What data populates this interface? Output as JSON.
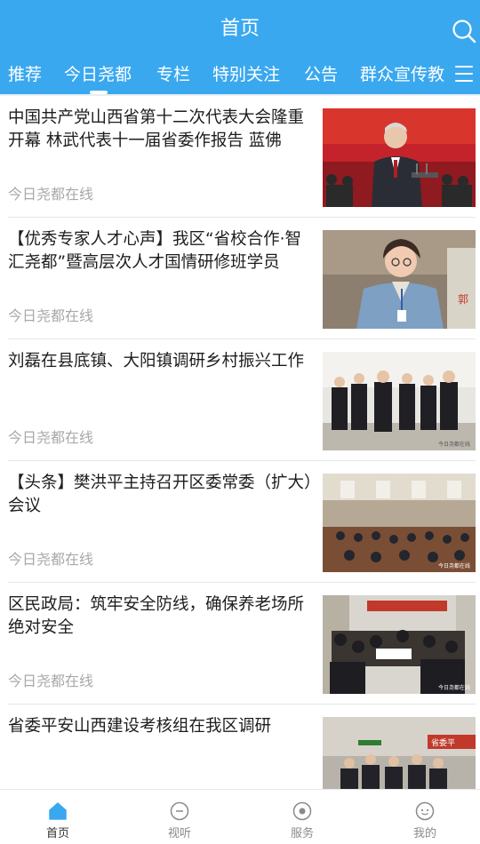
{
  "header": {
    "title": "首页",
    "tabs": [
      {
        "label": "推荐"
      },
      {
        "label": "今日尧都"
      },
      {
        "label": "专栏"
      },
      {
        "label": "特别关注"
      },
      {
        "label": "公告"
      },
      {
        "label": "群众宣传教"
      }
    ],
    "active_tab": "今日尧都",
    "accent_color": "#3aa8ef"
  },
  "articles": [
    {
      "title": "中国共产党山西省第十二次代表大会隆重开幕 林武代表十一届省委作报告 蓝佛",
      "source": "今日尧都在线"
    },
    {
      "title": "【优秀专家人才心声】我区“省校合作·智汇尧都”暨高层次人才国情研修班学员",
      "source": "今日尧都在线"
    },
    {
      "title": "刘磊在县底镇、大阳镇调研乡村振兴工作",
      "source": "今日尧都在线"
    },
    {
      "title": "【头条】樊洪平主持召开区委常委（扩大）会议",
      "source": "今日尧都在线"
    },
    {
      "title": "区民政局：筑牢安全防线，确保养老场所绝对安全",
      "source": "今日尧都在线"
    },
    {
      "title": "省委平安山西建设考核组在我区调研",
      "source": ""
    }
  ],
  "tabbar": {
    "items": [
      {
        "label": "首页",
        "icon": "home-icon"
      },
      {
        "label": "视听",
        "icon": "video-icon"
      },
      {
        "label": "服务",
        "icon": "service-icon"
      },
      {
        "label": "我的",
        "icon": "profile-icon"
      }
    ],
    "active": "首页"
  }
}
